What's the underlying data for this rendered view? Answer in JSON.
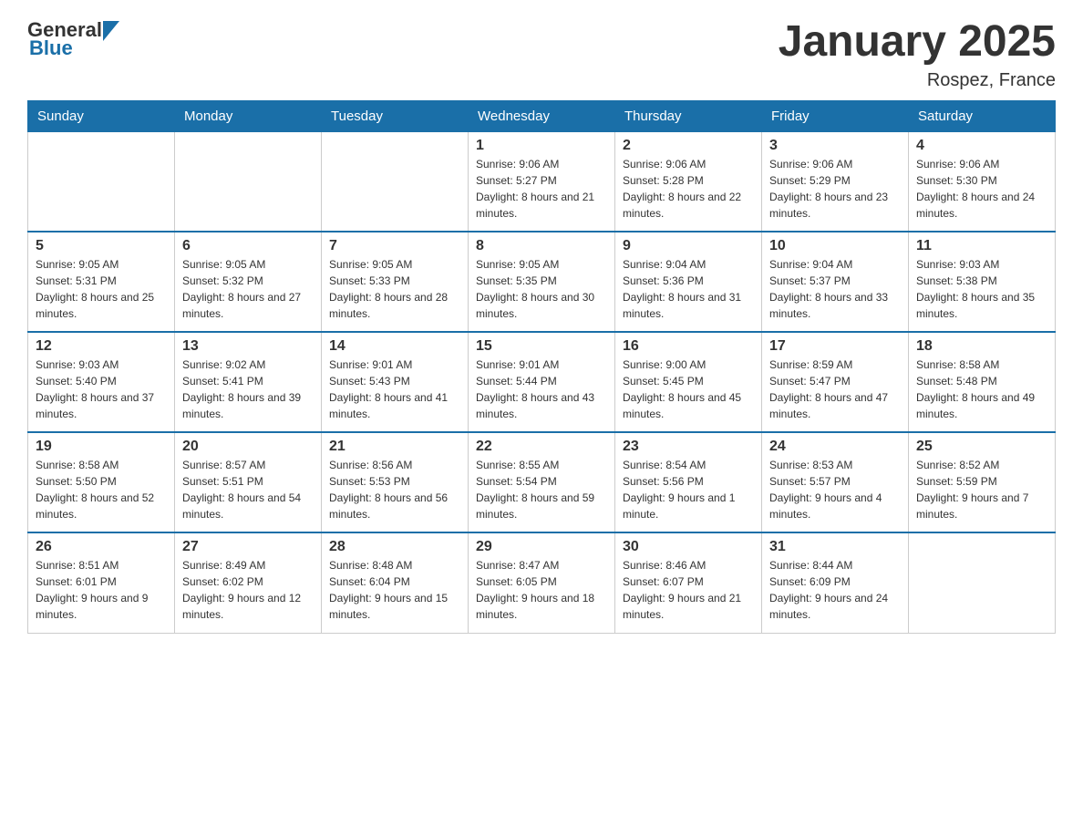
{
  "header": {
    "logo_general": "General",
    "logo_blue": "Blue",
    "title": "January 2025",
    "location": "Rospez, France"
  },
  "days_of_week": [
    "Sunday",
    "Monday",
    "Tuesday",
    "Wednesday",
    "Thursday",
    "Friday",
    "Saturday"
  ],
  "weeks": [
    [
      {
        "day": "",
        "sunrise": "",
        "sunset": "",
        "daylight": ""
      },
      {
        "day": "",
        "sunrise": "",
        "sunset": "",
        "daylight": ""
      },
      {
        "day": "",
        "sunrise": "",
        "sunset": "",
        "daylight": ""
      },
      {
        "day": "1",
        "sunrise": "Sunrise: 9:06 AM",
        "sunset": "Sunset: 5:27 PM",
        "daylight": "Daylight: 8 hours and 21 minutes."
      },
      {
        "day": "2",
        "sunrise": "Sunrise: 9:06 AM",
        "sunset": "Sunset: 5:28 PM",
        "daylight": "Daylight: 8 hours and 22 minutes."
      },
      {
        "day": "3",
        "sunrise": "Sunrise: 9:06 AM",
        "sunset": "Sunset: 5:29 PM",
        "daylight": "Daylight: 8 hours and 23 minutes."
      },
      {
        "day": "4",
        "sunrise": "Sunrise: 9:06 AM",
        "sunset": "Sunset: 5:30 PM",
        "daylight": "Daylight: 8 hours and 24 minutes."
      }
    ],
    [
      {
        "day": "5",
        "sunrise": "Sunrise: 9:05 AM",
        "sunset": "Sunset: 5:31 PM",
        "daylight": "Daylight: 8 hours and 25 minutes."
      },
      {
        "day": "6",
        "sunrise": "Sunrise: 9:05 AM",
        "sunset": "Sunset: 5:32 PM",
        "daylight": "Daylight: 8 hours and 27 minutes."
      },
      {
        "day": "7",
        "sunrise": "Sunrise: 9:05 AM",
        "sunset": "Sunset: 5:33 PM",
        "daylight": "Daylight: 8 hours and 28 minutes."
      },
      {
        "day": "8",
        "sunrise": "Sunrise: 9:05 AM",
        "sunset": "Sunset: 5:35 PM",
        "daylight": "Daylight: 8 hours and 30 minutes."
      },
      {
        "day": "9",
        "sunrise": "Sunrise: 9:04 AM",
        "sunset": "Sunset: 5:36 PM",
        "daylight": "Daylight: 8 hours and 31 minutes."
      },
      {
        "day": "10",
        "sunrise": "Sunrise: 9:04 AM",
        "sunset": "Sunset: 5:37 PM",
        "daylight": "Daylight: 8 hours and 33 minutes."
      },
      {
        "day": "11",
        "sunrise": "Sunrise: 9:03 AM",
        "sunset": "Sunset: 5:38 PM",
        "daylight": "Daylight: 8 hours and 35 minutes."
      }
    ],
    [
      {
        "day": "12",
        "sunrise": "Sunrise: 9:03 AM",
        "sunset": "Sunset: 5:40 PM",
        "daylight": "Daylight: 8 hours and 37 minutes."
      },
      {
        "day": "13",
        "sunrise": "Sunrise: 9:02 AM",
        "sunset": "Sunset: 5:41 PM",
        "daylight": "Daylight: 8 hours and 39 minutes."
      },
      {
        "day": "14",
        "sunrise": "Sunrise: 9:01 AM",
        "sunset": "Sunset: 5:43 PM",
        "daylight": "Daylight: 8 hours and 41 minutes."
      },
      {
        "day": "15",
        "sunrise": "Sunrise: 9:01 AM",
        "sunset": "Sunset: 5:44 PM",
        "daylight": "Daylight: 8 hours and 43 minutes."
      },
      {
        "day": "16",
        "sunrise": "Sunrise: 9:00 AM",
        "sunset": "Sunset: 5:45 PM",
        "daylight": "Daylight: 8 hours and 45 minutes."
      },
      {
        "day": "17",
        "sunrise": "Sunrise: 8:59 AM",
        "sunset": "Sunset: 5:47 PM",
        "daylight": "Daylight: 8 hours and 47 minutes."
      },
      {
        "day": "18",
        "sunrise": "Sunrise: 8:58 AM",
        "sunset": "Sunset: 5:48 PM",
        "daylight": "Daylight: 8 hours and 49 minutes."
      }
    ],
    [
      {
        "day": "19",
        "sunrise": "Sunrise: 8:58 AM",
        "sunset": "Sunset: 5:50 PM",
        "daylight": "Daylight: 8 hours and 52 minutes."
      },
      {
        "day": "20",
        "sunrise": "Sunrise: 8:57 AM",
        "sunset": "Sunset: 5:51 PM",
        "daylight": "Daylight: 8 hours and 54 minutes."
      },
      {
        "day": "21",
        "sunrise": "Sunrise: 8:56 AM",
        "sunset": "Sunset: 5:53 PM",
        "daylight": "Daylight: 8 hours and 56 minutes."
      },
      {
        "day": "22",
        "sunrise": "Sunrise: 8:55 AM",
        "sunset": "Sunset: 5:54 PM",
        "daylight": "Daylight: 8 hours and 59 minutes."
      },
      {
        "day": "23",
        "sunrise": "Sunrise: 8:54 AM",
        "sunset": "Sunset: 5:56 PM",
        "daylight": "Daylight: 9 hours and 1 minute."
      },
      {
        "day": "24",
        "sunrise": "Sunrise: 8:53 AM",
        "sunset": "Sunset: 5:57 PM",
        "daylight": "Daylight: 9 hours and 4 minutes."
      },
      {
        "day": "25",
        "sunrise": "Sunrise: 8:52 AM",
        "sunset": "Sunset: 5:59 PM",
        "daylight": "Daylight: 9 hours and 7 minutes."
      }
    ],
    [
      {
        "day": "26",
        "sunrise": "Sunrise: 8:51 AM",
        "sunset": "Sunset: 6:01 PM",
        "daylight": "Daylight: 9 hours and 9 minutes."
      },
      {
        "day": "27",
        "sunrise": "Sunrise: 8:49 AM",
        "sunset": "Sunset: 6:02 PM",
        "daylight": "Daylight: 9 hours and 12 minutes."
      },
      {
        "day": "28",
        "sunrise": "Sunrise: 8:48 AM",
        "sunset": "Sunset: 6:04 PM",
        "daylight": "Daylight: 9 hours and 15 minutes."
      },
      {
        "day": "29",
        "sunrise": "Sunrise: 8:47 AM",
        "sunset": "Sunset: 6:05 PM",
        "daylight": "Daylight: 9 hours and 18 minutes."
      },
      {
        "day": "30",
        "sunrise": "Sunrise: 8:46 AM",
        "sunset": "Sunset: 6:07 PM",
        "daylight": "Daylight: 9 hours and 21 minutes."
      },
      {
        "day": "31",
        "sunrise": "Sunrise: 8:44 AM",
        "sunset": "Sunset: 6:09 PM",
        "daylight": "Daylight: 9 hours and 24 minutes."
      },
      {
        "day": "",
        "sunrise": "",
        "sunset": "",
        "daylight": ""
      }
    ]
  ],
  "colors": {
    "header_bg": "#1a6fa8",
    "header_text": "#ffffff",
    "border": "#cccccc",
    "text": "#333333",
    "logo_blue": "#1a6fa8"
  }
}
